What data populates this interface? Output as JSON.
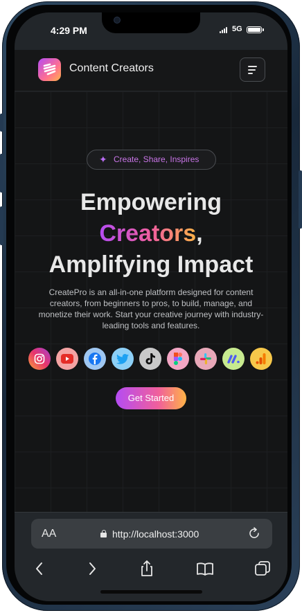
{
  "status_bar": {
    "time": "4:29 PM",
    "network": "5G"
  },
  "app": {
    "brand_name": "Content Creators",
    "accent_gradient": [
      "#b44cf3",
      "#f05f9c",
      "#ffb347"
    ]
  },
  "hero": {
    "tagline": "Create, Share, Inspires",
    "headline_line1": "Empowering",
    "headline_highlight": "Creators",
    "headline_comma": ",",
    "headline_line3": "Amplifying Impact",
    "description": "CreatePro is an all-in-one platform designed for content creators, from beginners to pros, to build, manage, and monetize their work. Start your creative journey with industry-leading tools and features.",
    "cta_label": "Get Started",
    "platform_icons": [
      "instagram-icon",
      "youtube-icon",
      "facebook-icon",
      "twitter-icon",
      "tiktok-icon",
      "figma-icon",
      "slack-icon",
      "monday-icon",
      "analytics-icon"
    ]
  },
  "browser": {
    "text_size_label": "AA",
    "url": "http://localhost:3000"
  }
}
